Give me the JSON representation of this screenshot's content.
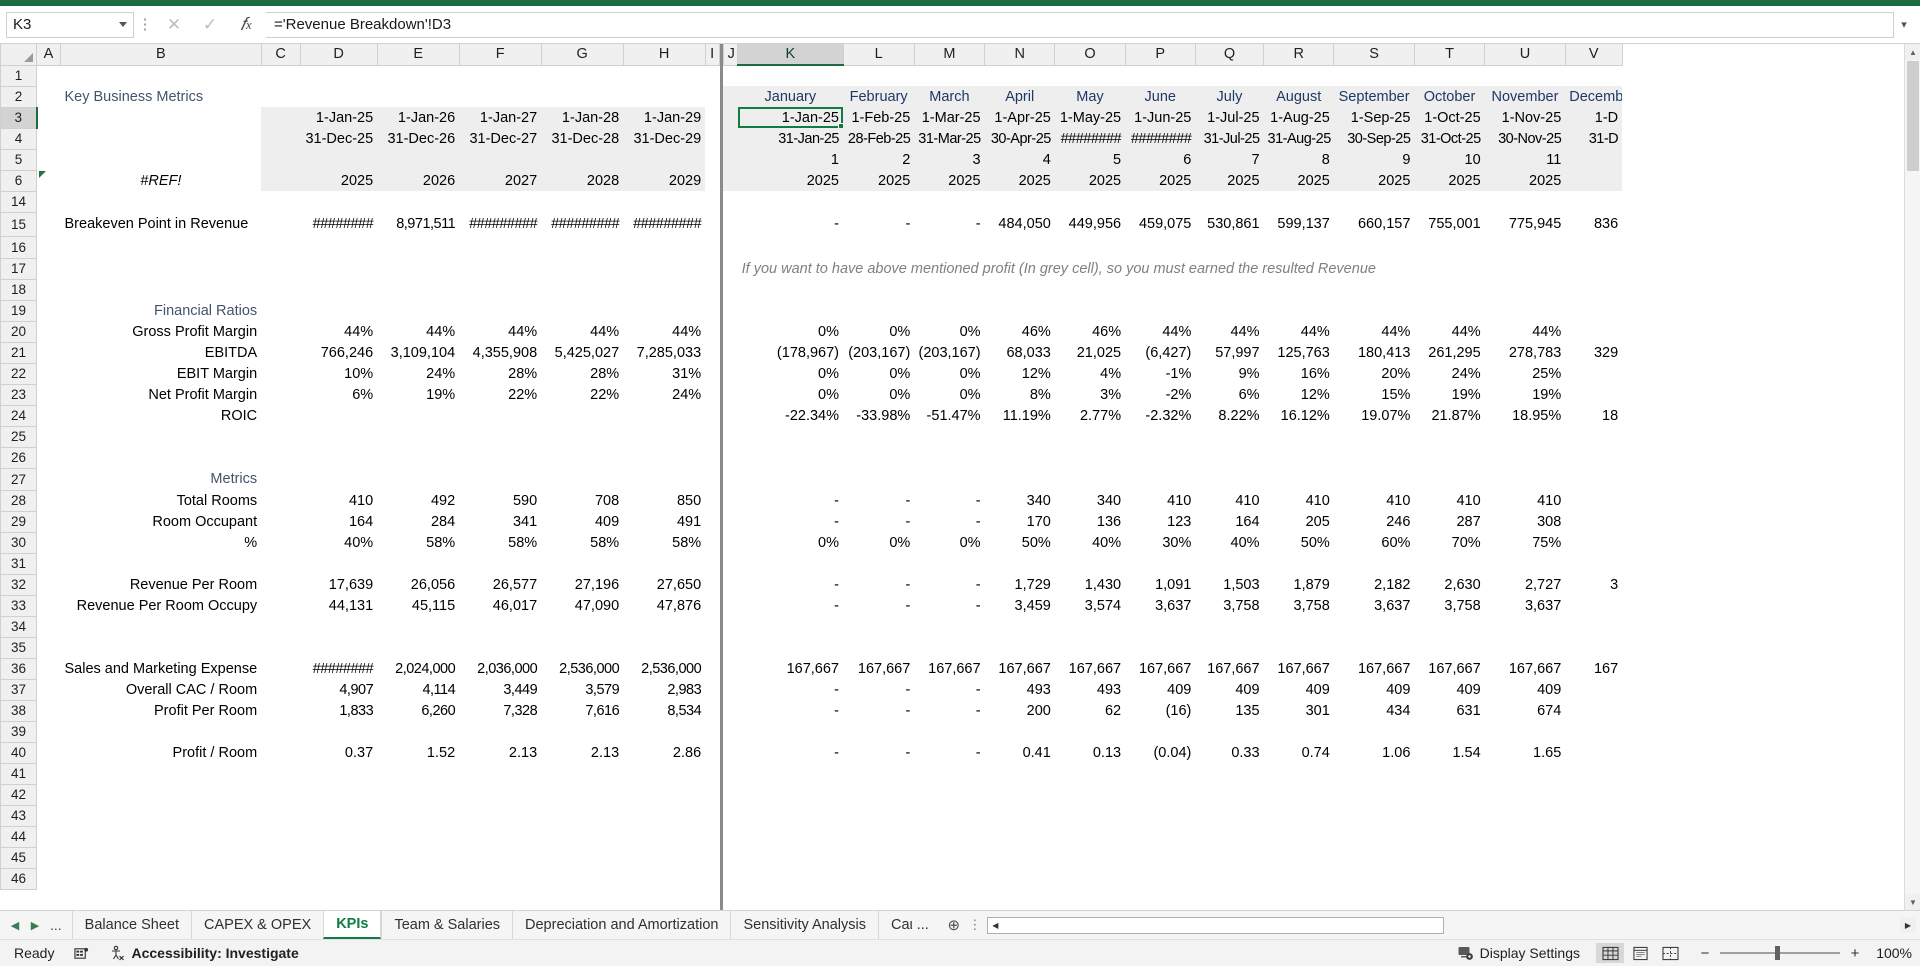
{
  "formula_bar": {
    "name_box": "K3",
    "formula": "='Revenue Breakdown'!D3",
    "cancel_icon": "close-icon",
    "confirm_icon": "check-icon",
    "fx_icon": "fx-icon"
  },
  "columns_left": [
    "A",
    "B",
    "C",
    "D",
    "E",
    "F",
    "G",
    "H",
    "I"
  ],
  "columns_right": [
    "J",
    "K",
    "L",
    "M",
    "N",
    "O",
    "P",
    "Q",
    "R",
    "S",
    "T",
    "U",
    "V"
  ],
  "selected_column": "K",
  "selected_row": "3",
  "row_numbers": [
    "1",
    "2",
    "3",
    "4",
    "5",
    "6",
    "14",
    "15",
    "16",
    "17",
    "18",
    "19",
    "20",
    "21",
    "22",
    "23",
    "24",
    "25",
    "26",
    "27",
    "28",
    "29",
    "30",
    "31",
    "32",
    "33",
    "34",
    "35",
    "36",
    "37",
    "38",
    "39",
    "40",
    "41",
    "42",
    "43",
    "44",
    "45",
    "46"
  ],
  "sheet": {
    "title": "Key Business Metrics",
    "ref_error": "#REF!",
    "note": "If you want to have above mentioned profit (In grey cell), so you must earned the resulted Revenue",
    "annual": {
      "start_dates": [
        "1-Jan-25",
        "1-Jan-26",
        "1-Jan-27",
        "1-Jan-28",
        "1-Jan-29"
      ],
      "end_dates": [
        "31-Dec-25",
        "31-Dec-26",
        "31-Dec-27",
        "31-Dec-28",
        "31-Dec-29"
      ],
      "years": [
        "2025",
        "2026",
        "2027",
        "2028",
        "2029"
      ]
    },
    "monthly": {
      "months": [
        "January",
        "February",
        "March",
        "April",
        "May",
        "June",
        "July",
        "August",
        "September",
        "October",
        "November",
        "December"
      ],
      "start_dates": [
        "1-Jan-25",
        "1-Feb-25",
        "1-Mar-25",
        "1-Apr-25",
        "1-May-25",
        "1-Jun-25",
        "1-Jul-25",
        "1-Aug-25",
        "1-Sep-25",
        "1-Oct-25",
        "1-Nov-25",
        "1-D"
      ],
      "end_dates": [
        "31-Jan-25",
        "28-Feb-25",
        "31-Mar-25",
        "30-Apr-25",
        "########",
        "########",
        "31-Jul-25",
        "31-Aug-25",
        "30-Sep-25",
        "31-Oct-25",
        "30-Nov-25",
        "31-D"
      ],
      "indexes": [
        "1",
        "2",
        "3",
        "4",
        "5",
        "6",
        "7",
        "8",
        "9",
        "10",
        "11",
        ""
      ],
      "years": [
        "2025",
        "2025",
        "2025",
        "2025",
        "2025",
        "2025",
        "2025",
        "2025",
        "2025",
        "2025",
        "2025",
        ""
      ]
    },
    "breakeven": {
      "label": "Breakeven Point in Revenue",
      "annual": [
        "########",
        "8,971,511",
        "#########",
        "#########",
        "#########"
      ],
      "monthly": [
        "-",
        "-",
        "-",
        "484,050",
        "449,956",
        "459,075",
        "530,861",
        "599,137",
        "660,157",
        "755,001",
        "775,945",
        "836"
      ]
    },
    "sections": {
      "financial_ratios": "Financial Ratios",
      "metrics": "Metrics"
    },
    "rows": [
      {
        "label": "Gross Profit Margin",
        "label_bold": true,
        "annual": [
          "44%",
          "44%",
          "44%",
          "44%",
          "44%"
        ],
        "monthly": [
          "0%",
          "0%",
          "0%",
          "46%",
          "46%",
          "44%",
          "44%",
          "44%",
          "44%",
          "44%",
          "44%",
          ""
        ]
      },
      {
        "label": "EBITDA",
        "label_bold": true,
        "annual": [
          "766,246",
          "3,109,104",
          "4,355,908",
          "5,425,027",
          "7,285,033"
        ],
        "monthly": [
          "(178,967)",
          "(203,167)",
          "(203,167)",
          "68,033",
          "21,025",
          "(6,427)",
          "57,997",
          "125,763",
          "180,413",
          "261,295",
          "278,783",
          "329"
        ]
      },
      {
        "label": "EBIT Margin",
        "label_bold": true,
        "annual": [
          "10%",
          "24%",
          "28%",
          "28%",
          "31%"
        ],
        "monthly": [
          "0%",
          "0%",
          "0%",
          "12%",
          "4%",
          "-1%",
          "9%",
          "16%",
          "20%",
          "24%",
          "25%",
          ""
        ]
      },
      {
        "label": "Net Profit Margin",
        "label_bold": true,
        "annual": [
          "6%",
          "19%",
          "22%",
          "22%",
          "24%"
        ],
        "monthly": [
          "0%",
          "0%",
          "0%",
          "8%",
          "3%",
          "-2%",
          "6%",
          "12%",
          "15%",
          "19%",
          "19%",
          ""
        ]
      },
      {
        "label": "ROIC",
        "label_bold": true,
        "annual": [
          "",
          "",
          "",
          "",
          ""
        ],
        "monthly": [
          "-22.34%",
          "-33.98%",
          "-51.47%",
          "11.19%",
          "2.77%",
          "-2.32%",
          "8.22%",
          "16.12%",
          "19.07%",
          "21.87%",
          "18.95%",
          "18"
        ]
      }
    ],
    "metric_rows": [
      {
        "label": "Total Rooms",
        "annual": [
          "410",
          "492",
          "590",
          "708",
          "850"
        ],
        "monthly": [
          "-",
          "-",
          "-",
          "340",
          "340",
          "410",
          "410",
          "410",
          "410",
          "410",
          "410",
          ""
        ]
      },
      {
        "label": "Room Occupant",
        "annual": [
          "164",
          "284",
          "341",
          "409",
          "491"
        ],
        "monthly": [
          "-",
          "-",
          "-",
          "170",
          "136",
          "123",
          "164",
          "205",
          "246",
          "287",
          "308",
          ""
        ]
      },
      {
        "label": "%",
        "annual": [
          "40%",
          "58%",
          "58%",
          "58%",
          "58%"
        ],
        "monthly": [
          "0%",
          "0%",
          "0%",
          "50%",
          "40%",
          "30%",
          "40%",
          "50%",
          "60%",
          "70%",
          "75%",
          ""
        ]
      }
    ],
    "revenue_rows": [
      {
        "label": "Revenue Per Room",
        "annual": [
          "17,639",
          "26,056",
          "26,577",
          "27,196",
          "27,650"
        ],
        "monthly": [
          "-",
          "-",
          "-",
          "1,729",
          "1,430",
          "1,091",
          "1,503",
          "1,879",
          "2,182",
          "2,630",
          "2,727",
          "3"
        ]
      },
      {
        "label": "Revenue Per Room Occupy",
        "annual": [
          "44,131",
          "45,115",
          "46,017",
          "47,090",
          "47,876"
        ],
        "monthly": [
          "-",
          "-",
          "-",
          "3,459",
          "3,574",
          "3,637",
          "3,758",
          "3,758",
          "3,637",
          "3,758",
          "3,637",
          ""
        ]
      }
    ],
    "expense_rows": [
      {
        "label": "Sales and Marketing Expense",
        "annual": [
          "########",
          "2,024,000",
          "2,036,000",
          "2,536,000",
          "2,536,000"
        ],
        "monthly": [
          "167,667",
          "167,667",
          "167,667",
          "167,667",
          "167,667",
          "167,667",
          "167,667",
          "167,667",
          "167,667",
          "167,667",
          "167,667",
          "167"
        ]
      },
      {
        "label": "Overall CAC / Room",
        "annual": [
          "4,907",
          "4,114",
          "3,449",
          "3,579",
          "2,983"
        ],
        "monthly": [
          "-",
          "-",
          "-",
          "493",
          "493",
          "409",
          "409",
          "409",
          "409",
          "409",
          "409",
          ""
        ]
      },
      {
        "label": "Profit Per Room",
        "annual": [
          "1,833",
          "6,260",
          "7,328",
          "7,616",
          "8,534"
        ],
        "monthly": [
          "-",
          "-",
          "-",
          "200",
          "62",
          "(16)",
          "135",
          "301",
          "434",
          "631",
          "674",
          ""
        ]
      }
    ],
    "profit_row": {
      "label": "Profit / Room",
      "annual": [
        "0.37",
        "1.52",
        "2.13",
        "2.13",
        "2.86"
      ],
      "monthly": [
        "-",
        "-",
        "-",
        "0.41",
        "0.13",
        "(0.04)",
        "0.33",
        "0.74",
        "1.06",
        "1.54",
        "1.65",
        ""
      ]
    }
  },
  "tabs": {
    "prev_icon": "prev-sheet-icon",
    "next_icon": "next-sheet-icon",
    "ellipsis": "...",
    "items": [
      {
        "label": "Balance Sheet",
        "active": false
      },
      {
        "label": "CAPEX & OPEX",
        "active": false
      },
      {
        "label": "KPIs",
        "active": true
      },
      {
        "label": "Team & Salaries",
        "active": false
      },
      {
        "label": "Depreciation and Amortization",
        "active": false
      },
      {
        "label": "Sensitivity Analysis",
        "active": false
      },
      {
        "label": "Caι ...",
        "active": false
      }
    ],
    "add_label": "+"
  },
  "status": {
    "ready": "Ready",
    "macro_icon": "record-macro-icon",
    "accessibility_icon": "accessibility-icon",
    "accessibility": "Accessibility: Investigate",
    "display_settings_icon": "display-settings-icon",
    "display_settings": "Display Settings",
    "view_normal_icon": "normal-view-icon",
    "view_pagelayout_icon": "page-layout-view-icon",
    "view_pagebreak_icon": "page-break-view-icon",
    "zoom_out": "−",
    "zoom_in": "+",
    "zoom_level": "100%"
  },
  "colors": {
    "accent": "#107c41",
    "header_navy": "#1f3864",
    "section_slate": "#44546a",
    "note_grey": "#808080"
  }
}
